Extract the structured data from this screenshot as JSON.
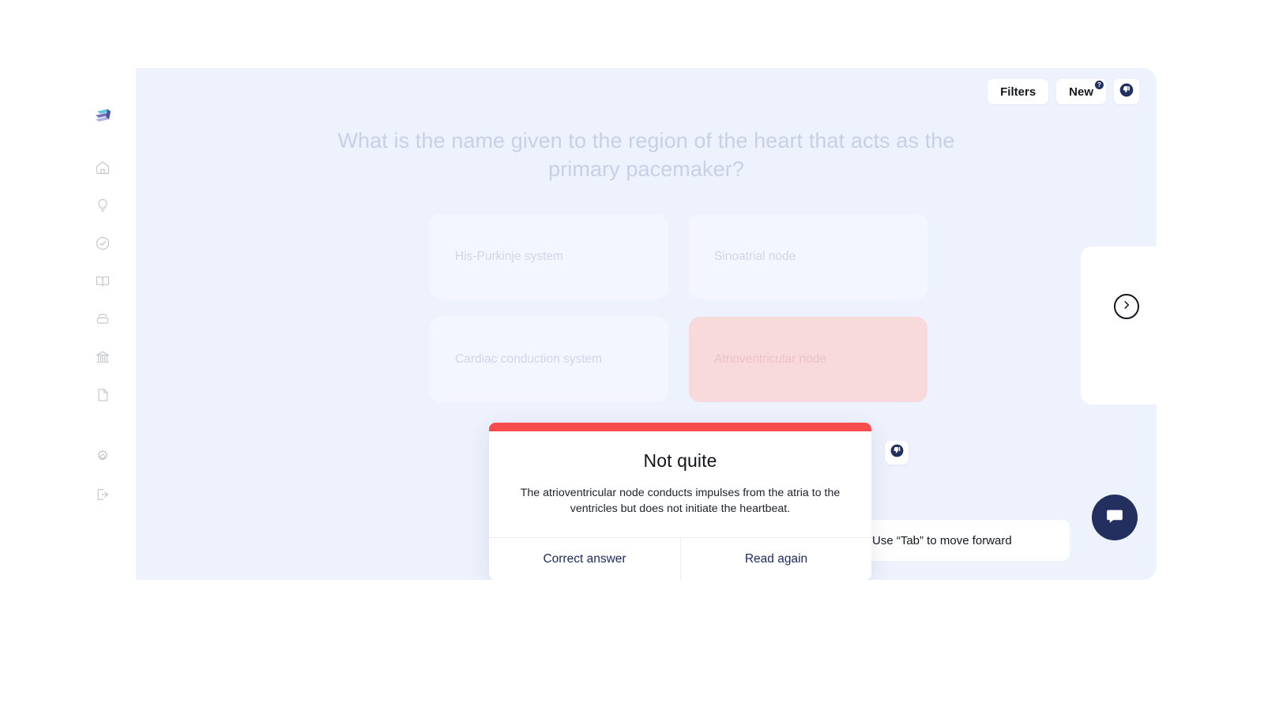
{
  "sidebar": {
    "logo_name": "layers-logo",
    "items": [
      {
        "icon": "home-icon",
        "name": "home"
      },
      {
        "icon": "lightbulb-icon",
        "name": "insights"
      },
      {
        "icon": "check-circle-icon",
        "name": "tasks"
      },
      {
        "icon": "book-icon",
        "name": "library"
      },
      {
        "icon": "archive-icon",
        "name": "archive"
      },
      {
        "icon": "bank-icon",
        "name": "institution"
      },
      {
        "icon": "document-icon",
        "name": "documents"
      }
    ],
    "footer_items": [
      {
        "icon": "gear-icon",
        "name": "settings"
      },
      {
        "icon": "logout-icon",
        "name": "logout"
      }
    ]
  },
  "topbar": {
    "filters_label": "Filters",
    "new_label": "New",
    "new_badge": "?",
    "feedback_icon": "thumbs-down-icon"
  },
  "quiz": {
    "question": "What is the name given to the region of the heart that acts as the primary pacemaker?",
    "options": [
      {
        "label": "His-Purkinje system",
        "state": "default"
      },
      {
        "label": "Sinoatrial node",
        "state": "default"
      },
      {
        "label": "Cardiac conduction system",
        "state": "default"
      },
      {
        "label": "Atrioventricular node",
        "state": "incorrect"
      }
    ]
  },
  "modal": {
    "title": "Not quite",
    "body": "The atrioventricular node conducts impulses from the atria to the ventricles but does not initiate the heartbeat.",
    "primary_action": "Correct answer",
    "secondary_action": "Read again",
    "accent_color": "#f94d4d"
  },
  "hints": {
    "tab_hint": "Use “Tab” to move forward"
  },
  "controls": {
    "next_icon": "chevron-right-circle-icon",
    "chat_icon": "chat-bubble-icon",
    "feedback_icon": "thumbs-down-icon"
  },
  "colors": {
    "app_background": "#eef2fd",
    "sidebar_background": "#ffffff",
    "accent_navy": "#23305f",
    "error_red": "#f94d4d",
    "wrong_option": "#f8dadd"
  }
}
